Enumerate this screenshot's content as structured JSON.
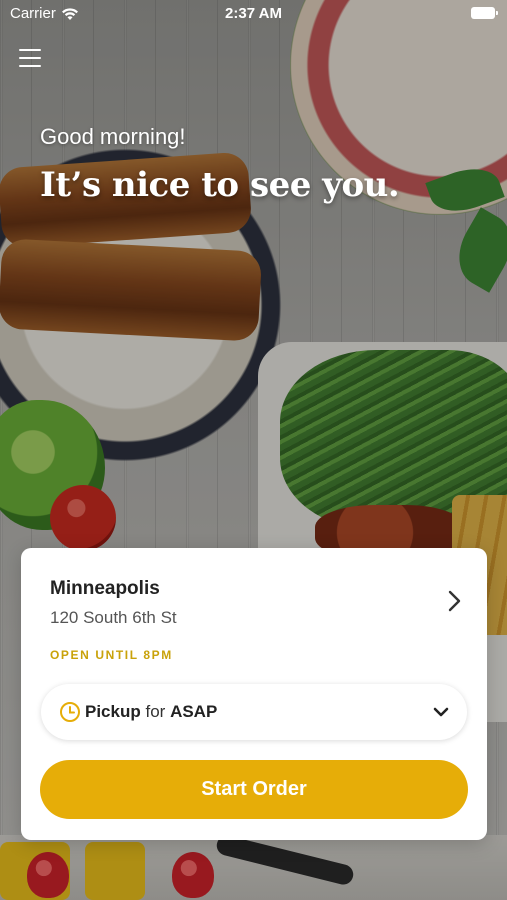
{
  "status_bar": {
    "carrier": "Carrier",
    "time": "2:37 AM",
    "icons": [
      "wifi-icon",
      "battery-icon"
    ]
  },
  "menu": {
    "icon": "hamburger-menu-icon"
  },
  "greeting": {
    "subtitle": "Good morning!",
    "headline": "It’s nice to see you."
  },
  "location": {
    "city": "Minneapolis",
    "address": "120 South 6th St",
    "hours": "OPEN UNTIL 8PM",
    "hours_color": "#c9a20a"
  },
  "order_mode": {
    "mode": "Pickup",
    "connector": "for",
    "time": "ASAP",
    "icon": "clock-icon"
  },
  "actions": {
    "start_order": "Start Order",
    "accent_color": "#e6ad08"
  }
}
